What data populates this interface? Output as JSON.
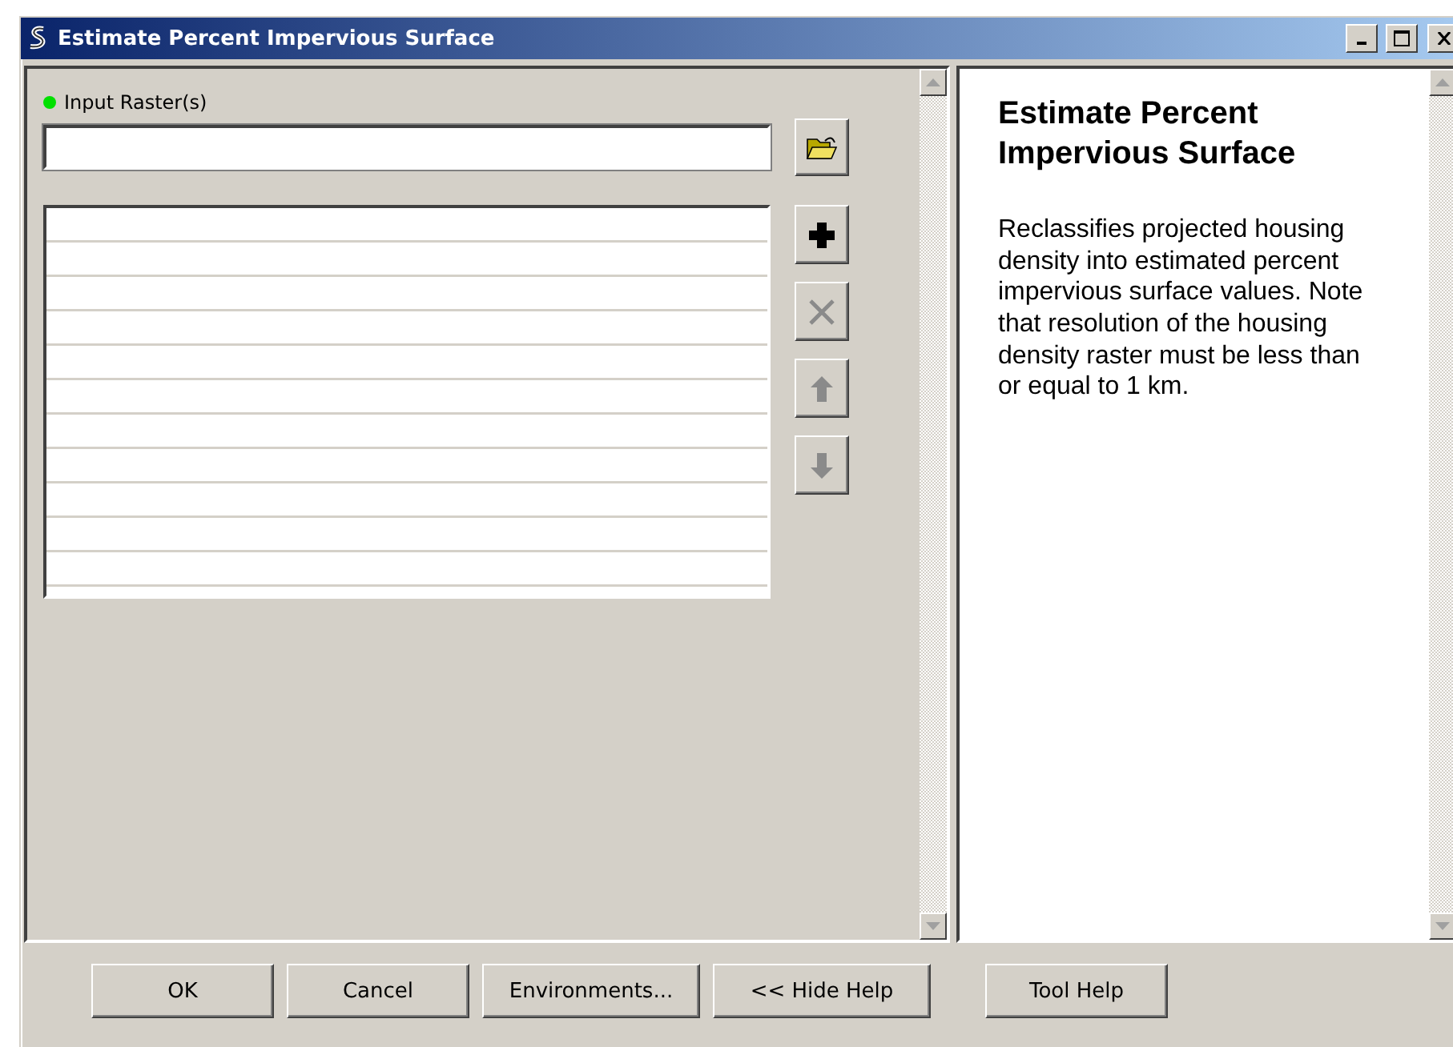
{
  "window": {
    "title": "Estimate Percent Impervious Surface"
  },
  "parameter": {
    "label": "Input Raster(s)",
    "required": true
  },
  "list_buttons": [
    {
      "kind": "add",
      "disabled": false
    },
    {
      "kind": "remove",
      "disabled": true
    },
    {
      "kind": "up",
      "disabled": true
    },
    {
      "kind": "down",
      "disabled": true
    }
  ],
  "help": {
    "title": "Estimate Percent Impervious Surface",
    "text": "Reclassifies projected housing density into estimated percent impervious surface values. Note that resolution of the housing density raster must be less than or equal to 1 km."
  },
  "buttons": [
    {
      "label": "OK"
    },
    {
      "label": "Cancel"
    },
    {
      "label": "Environments..."
    },
    {
      "label": "<< Hide Help"
    },
    {
      "label": "Tool Help",
      "separated": true
    }
  ]
}
